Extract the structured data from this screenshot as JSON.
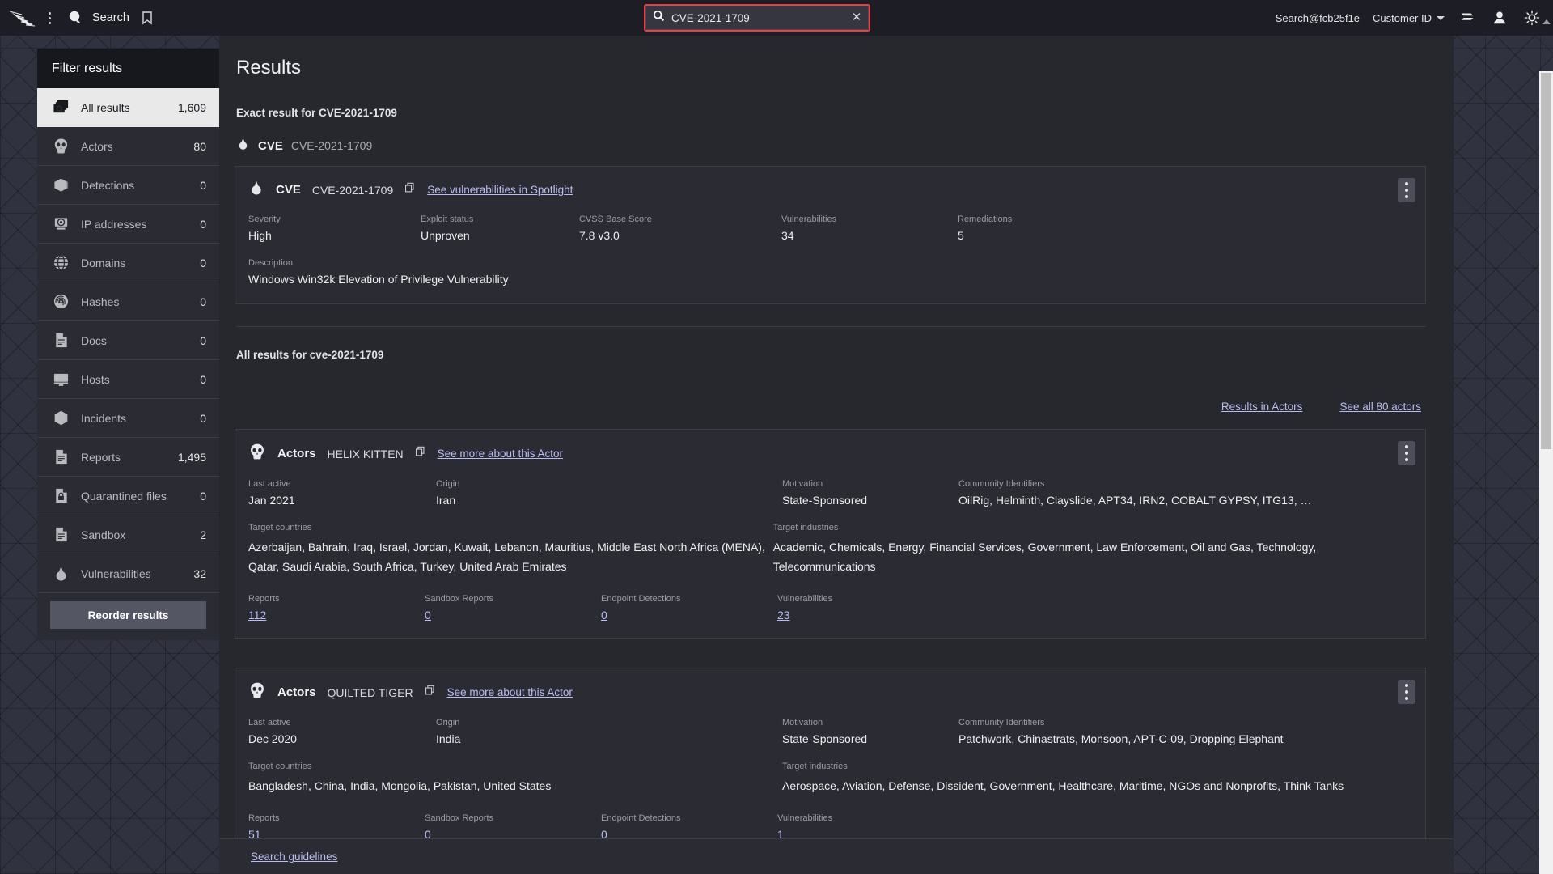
{
  "topbar": {
    "logo_icon": "falcon-logo-icon",
    "menu_icon": "kebab-menu-icon",
    "search_icon": "search-icon",
    "app_label": "Search",
    "bookmark_icon": "bookmark-icon",
    "account_label": "Search@fcb25f1e",
    "customer_id_label": "Customer ID",
    "chevron_icon": "chevron-down-icon",
    "layers_icon": "layers-icon",
    "user_icon": "user-icon",
    "brightness_icon": "sun-brightness-icon",
    "highlight_color": "#f03c3c"
  },
  "search": {
    "value": "CVE-2021-1709",
    "placeholder": "Search",
    "clear_label": "✕"
  },
  "sidebar": {
    "title": "Filter results",
    "items": [
      {
        "icon": "all-results-icon",
        "label": "All results",
        "count": "1,609",
        "active": true
      },
      {
        "icon": "actors-skull-icon",
        "label": "Actors",
        "count": "80",
        "active": false
      },
      {
        "icon": "detections-cube-icon",
        "label": "Detections",
        "count": "0",
        "active": false
      },
      {
        "icon": "ip-address-monitor-icon",
        "label": "IP addresses",
        "count": "0",
        "active": false
      },
      {
        "icon": "domains-globe-icon",
        "label": "Domains",
        "count": "0",
        "active": false
      },
      {
        "icon": "hashes-fingerprint-icon",
        "label": "Hashes",
        "count": "0",
        "active": false
      },
      {
        "icon": "docs-document-icon",
        "label": "Docs",
        "count": "0",
        "active": false
      },
      {
        "icon": "hosts-monitor-icon",
        "label": "Hosts",
        "count": "0",
        "active": false
      },
      {
        "icon": "incidents-hexagon-icon",
        "label": "Incidents",
        "count": "0",
        "active": false
      },
      {
        "icon": "reports-document-icon",
        "label": "Reports",
        "count": "1,495",
        "active": false
      },
      {
        "icon": "quarantined-lock-icon",
        "label": "Quarantined files",
        "count": "0",
        "active": false
      },
      {
        "icon": "sandbox-document-icon",
        "label": "Sandbox",
        "count": "2",
        "active": false
      },
      {
        "icon": "vulnerabilities-icon",
        "label": "Vulnerabilities",
        "count": "32",
        "active": false
      }
    ],
    "reorder_label": "Reorder results"
  },
  "main": {
    "page_title": "Results",
    "exact_section_label": "Exact result for CVE-2021-1709",
    "exact_head": {
      "kind": "CVE",
      "value": "CVE-2021-1709",
      "icon": "vulnerability-icon"
    },
    "cve_card": {
      "kind": "CVE",
      "name": "CVE-2021-1709",
      "copy_icon": "copy-icon",
      "link": "See vulnerabilities in Spotlight",
      "kebab_icon": "kebab-menu-icon",
      "fields": [
        {
          "label": "Severity",
          "value": "High"
        },
        {
          "label": "Exploit status",
          "value": "Unproven"
        },
        {
          "label": "CVSS Base Score",
          "value": "7.8 v3.0"
        },
        {
          "label": "Vulnerabilities",
          "value": "34"
        },
        {
          "label": "Remediations",
          "value": "5"
        }
      ],
      "description_label": "Description",
      "description_value": "Windows Win32k Elevation of Privilege Vulnerability"
    },
    "all_results_label": "All results for cve-2021-1709",
    "actor_links": {
      "results_in_actors": "Results in Actors",
      "see_all_actors": "See all 80 actors"
    },
    "actors": [
      {
        "kind": "Actors",
        "name": "HELIX KITTEN",
        "icon": "actors-skull-icon",
        "copy_icon": "copy-icon",
        "link": "See more about this Actor",
        "kebab_icon": "kebab-menu-icon",
        "last_active_label": "Last active",
        "last_active_value": "Jan 2021",
        "origin_label": "Origin",
        "origin_value": "Iran",
        "motivation_label": "Motivation",
        "motivation_value": "State-Sponsored",
        "community_label": "Community Identifiers",
        "community_value": "OilRig, Helminth, Clayslide, APT34, IRN2, COBALT GYPSY, ITG13, …",
        "target_countries_label": "Target countries",
        "target_countries_value": "Azerbaijan, Bahrain, Iraq, Israel, Jordan, Kuwait, Lebanon, Mauritius, Middle East North Africa (MENA), Qatar, Saudi Arabia, South Africa, Turkey, United Arab Emirates",
        "target_industries_label": "Target industries",
        "target_industries_value": "Academic, Chemicals, Energy, Financial Services, Government, Law Enforcement, Oil and Gas, Technology, Telecommunications",
        "stats": [
          {
            "label": "Reports",
            "value": "112"
          },
          {
            "label": "Sandbox Reports",
            "value": "0"
          },
          {
            "label": "Endpoint Detections",
            "value": "0"
          },
          {
            "label": "Vulnerabilities",
            "value": "23"
          }
        ]
      },
      {
        "kind": "Actors",
        "name": "QUILTED TIGER",
        "icon": "actors-skull-icon",
        "copy_icon": "copy-icon",
        "link": "See more about this Actor",
        "kebab_icon": "kebab-menu-icon",
        "last_active_label": "Last active",
        "last_active_value": "Dec 2020",
        "origin_label": "Origin",
        "origin_value": "India",
        "motivation_label": "Motivation",
        "motivation_value": "State-Sponsored",
        "community_label": "Community Identifiers",
        "community_value": "Patchwork, Chinastrats, Monsoon, APT-C-09, Dropping Elephant",
        "target_countries_label": "Target countries",
        "target_countries_value": "Bangladesh, China, India, Mongolia, Pakistan, United States",
        "target_industries_label": "Target industries",
        "target_industries_value": "Aerospace, Aviation, Defense, Dissident, Government, Healthcare, Maritime, NGOs and Nonprofits, Think Tanks",
        "stats": [
          {
            "label": "Reports",
            "value": "51"
          },
          {
            "label": "Sandbox Reports",
            "value": "0"
          },
          {
            "label": "Endpoint Detections",
            "value": "0"
          },
          {
            "label": "Vulnerabilities",
            "value": "1"
          }
        ]
      }
    ]
  },
  "footer": {
    "guidelines_link": "Search guidelines"
  }
}
